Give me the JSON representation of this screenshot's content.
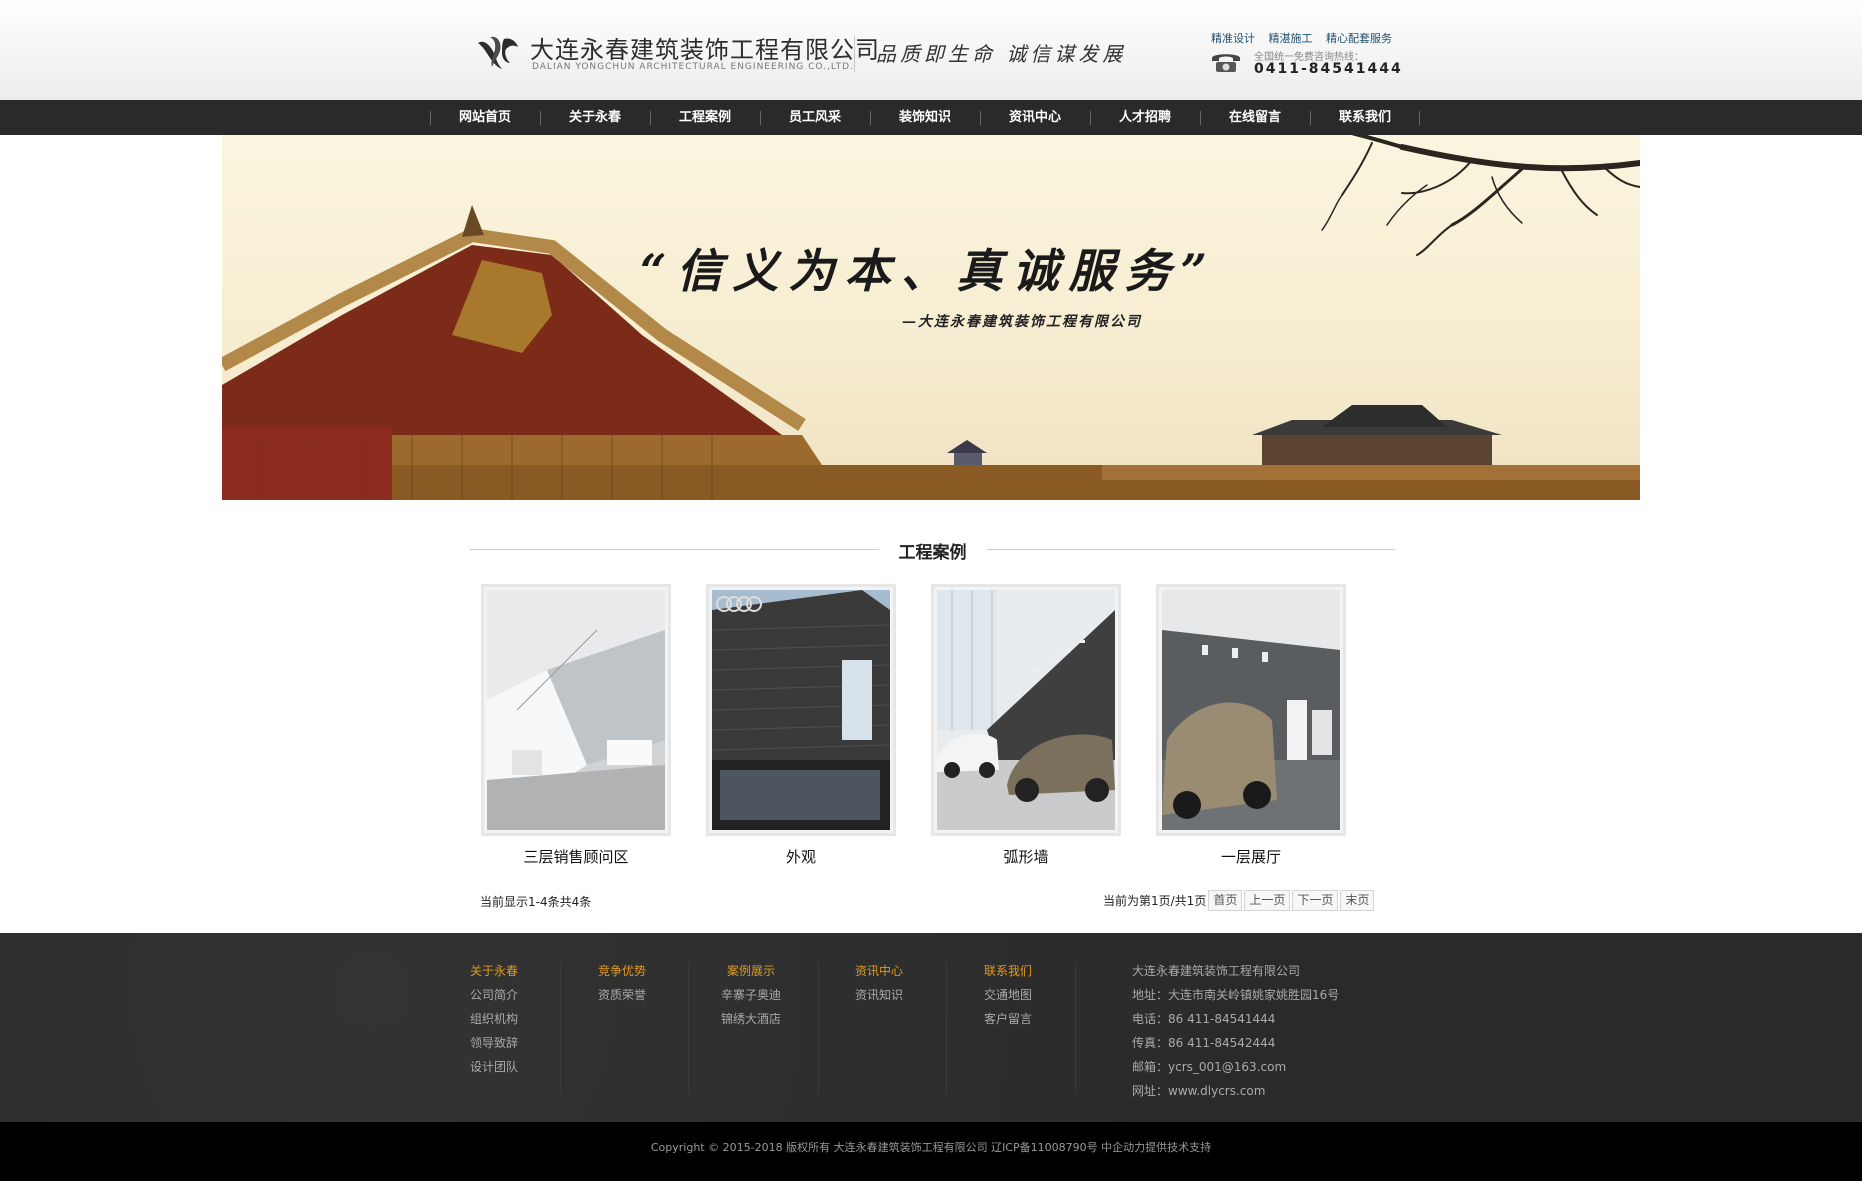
{
  "header": {
    "company_cn": "大连永春建筑装饰工程有限公司",
    "company_en": "DALIAN YONGCHUN ARCHITECTURAL ENGINEERING CO.,LTD.",
    "slogan": "品质即生命  诚信谋发展",
    "services": [
      "精准设计",
      "精湛施工",
      "精心配套服务"
    ],
    "hotline_label": "全国统一免费咨询热线：",
    "hotline_number": "0411-84541444",
    "logo_icon": "yc-logo-icon",
    "phone_icon": "telephone-icon"
  },
  "nav": {
    "items": [
      "网站首页",
      "关于永春",
      "工程案例",
      "员工风采",
      "装饰知识",
      "资讯中心",
      "人才招聘",
      "在线留言",
      "联系我们"
    ]
  },
  "banner": {
    "quote": "“信义为本、真诚服务”",
    "signature": "—大连永春建筑装饰工程有限公司"
  },
  "section": {
    "title": "工程案例"
  },
  "cases": [
    {
      "caption": "三层销售顾问区"
    },
    {
      "caption": "外观"
    },
    {
      "caption": "弧形墙"
    },
    {
      "caption": "一层展厅"
    }
  ],
  "pager": {
    "summary": "当前显示1-4条共4条",
    "page_info": "当前为第1页/共1页",
    "first": "首页",
    "prev": "上一页",
    "next": "下一页",
    "last": "末页"
  },
  "footer": {
    "columns": [
      {
        "head": "关于永春",
        "items": [
          "公司简介",
          "组织机构",
          "领导致辞",
          "设计团队"
        ]
      },
      {
        "head": "竞争优势",
        "items": [
          "资质荣誉"
        ]
      },
      {
        "head": "案例展示",
        "items": [
          "辛寨子奥迪",
          "锦绣大酒店"
        ]
      },
      {
        "head": "资讯中心",
        "items": [
          "资讯知识"
        ]
      },
      {
        "head": "联系我们",
        "items": [
          "交通地图",
          "客户留言"
        ]
      }
    ],
    "contact": {
      "company": "大连永春建筑装饰工程有限公司",
      "address": "地址：大连市南关岭镇姚家姚胜园16号",
      "phone": "电话：86 411-84541444",
      "fax": "传真：86 411-84542444",
      "email": "邮箱：ycrs_001@163.com",
      "website": "网址：www.dlycrs.com"
    },
    "copyright": "Copyright © 2015-2018 版权所有 大连永春建筑装饰工程有限公司 辽ICP备11008790号 中企动力提供技术支持"
  },
  "colors": {
    "nav_bg": "#2a2a2a",
    "footer_bg": "#2c2c2c",
    "footer_heading": "#e19a1e",
    "copyright_bg": "#000000"
  }
}
